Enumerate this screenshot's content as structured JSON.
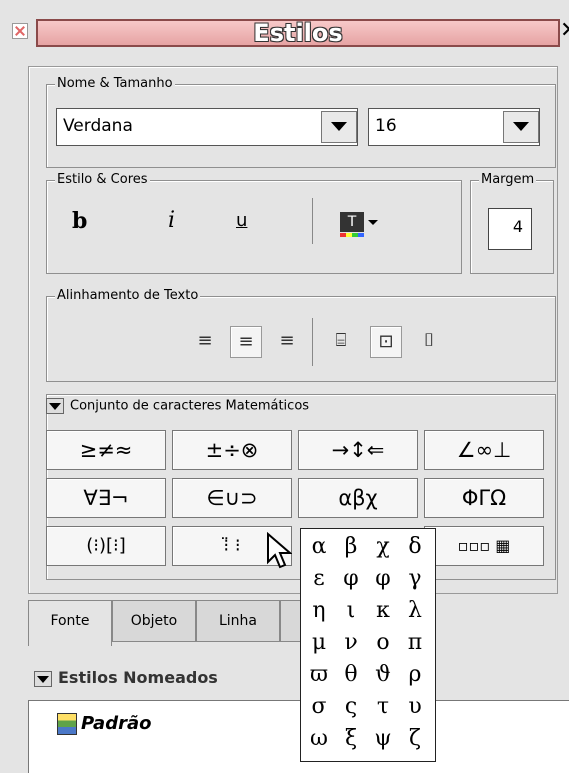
{
  "title": "Estilos",
  "font_group": {
    "legend": "Nome & Tamanho",
    "font_name": "Verdana",
    "font_size": "16"
  },
  "style_group": {
    "legend": "Estilo & Cores",
    "bold": "b",
    "italic": "i",
    "underline": "u",
    "color_btn": "T"
  },
  "margin_group": {
    "legend": "Margem",
    "value": "4"
  },
  "align_group": {
    "legend": "Alinhamento de Texto"
  },
  "charset": {
    "label": "Conjunto de caracteres Matemáticos",
    "rows": [
      [
        "≥≠≈",
        "±÷⊗",
        "→↕⇐",
        "∠∞⊥"
      ],
      [
        "∀∃¬",
        "∈∪⊃",
        "αβχ",
        "ΦΓΩ"
      ],
      [
        "(⁝)[⁝]",
        "⁝̈ ⁝",
        "",
        "▫▫▫ ▦"
      ]
    ]
  },
  "popup_greek": [
    [
      "α",
      "β",
      "χ",
      "δ"
    ],
    [
      "ε",
      "φ",
      "φ",
      "γ"
    ],
    [
      "η",
      "ι",
      "κ",
      "λ"
    ],
    [
      "μ",
      "ν",
      "ο",
      "π"
    ],
    [
      "ϖ",
      "θ",
      "ϑ",
      "ρ"
    ],
    [
      "σ",
      "ς",
      "τ",
      "υ"
    ],
    [
      "ω",
      "ξ",
      "ψ",
      "ζ"
    ]
  ],
  "tabs": [
    "Fonte",
    "Objeto",
    "Linha"
  ],
  "named_styles": {
    "header": "Estilos Nomeados",
    "item": "Padrão"
  }
}
